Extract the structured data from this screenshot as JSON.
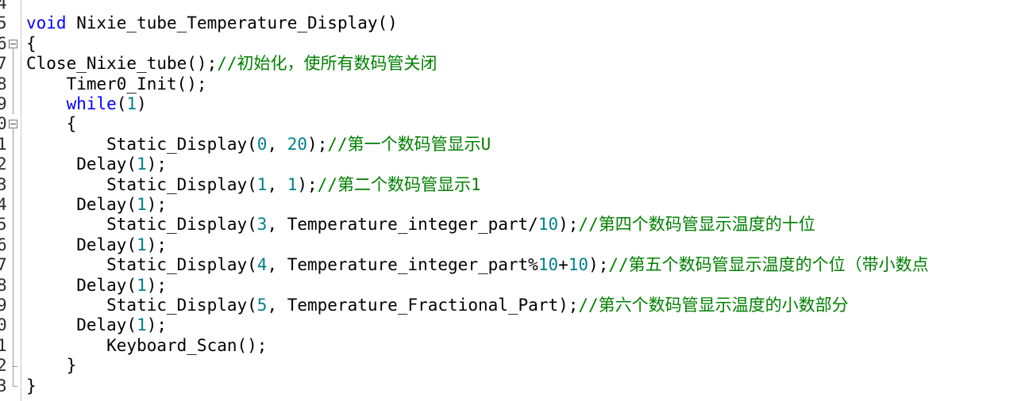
{
  "editor": {
    "colors": {
      "keyword": "#0000ff",
      "number": "#00808c",
      "comment": "#008000",
      "text": "#000000",
      "line_number": "#2b2b2b"
    },
    "lines": [
      {
        "number": "4",
        "fold": "none",
        "segments": []
      },
      {
        "number": "5",
        "fold": "none",
        "segments": [
          {
            "t": "kw",
            "v": "void"
          },
          {
            "t": "pl",
            "v": " Nixie_tube_Temperature_Display()"
          }
        ]
      },
      {
        "number": "6",
        "fold": "open",
        "segments": [
          {
            "t": "pl",
            "v": "{"
          }
        ]
      },
      {
        "number": "7",
        "fold": "line",
        "segments": [
          {
            "t": "pl",
            "v": "Close_Nixie_tube();"
          },
          {
            "t": "cmt",
            "v": "//初始化，使所有数码管关闭"
          }
        ]
      },
      {
        "number": "8",
        "fold": "line",
        "segments": [
          {
            "t": "pl",
            "v": "    Timer0_Init();"
          }
        ]
      },
      {
        "number": "9",
        "fold": "line",
        "segments": [
          {
            "t": "pl",
            "v": "    "
          },
          {
            "t": "kw",
            "v": "while"
          },
          {
            "t": "pl",
            "v": "("
          },
          {
            "t": "num",
            "v": "1"
          },
          {
            "t": "pl",
            "v": ")"
          }
        ]
      },
      {
        "number": "0",
        "fold": "open",
        "segments": [
          {
            "t": "pl",
            "v": "    {"
          }
        ]
      },
      {
        "number": "1",
        "fold": "line",
        "segments": [
          {
            "t": "pl",
            "v": "        Static_Display("
          },
          {
            "t": "num",
            "v": "0"
          },
          {
            "t": "pl",
            "v": ", "
          },
          {
            "t": "num",
            "v": "20"
          },
          {
            "t": "pl",
            "v": ");"
          },
          {
            "t": "cmt",
            "v": "//第一个数码管显示U"
          }
        ]
      },
      {
        "number": "2",
        "fold": "line",
        "segments": [
          {
            "t": "pl",
            "v": "     Delay("
          },
          {
            "t": "num",
            "v": "1"
          },
          {
            "t": "pl",
            "v": ");"
          }
        ]
      },
      {
        "number": "3",
        "fold": "line",
        "segments": [
          {
            "t": "pl",
            "v": "        Static_Display("
          },
          {
            "t": "num",
            "v": "1"
          },
          {
            "t": "pl",
            "v": ", "
          },
          {
            "t": "num",
            "v": "1"
          },
          {
            "t": "pl",
            "v": ");"
          },
          {
            "t": "cmt",
            "v": "//第二个数码管显示1"
          }
        ]
      },
      {
        "number": "4",
        "fold": "line",
        "segments": [
          {
            "t": "pl",
            "v": "     Delay("
          },
          {
            "t": "num",
            "v": "1"
          },
          {
            "t": "pl",
            "v": ");"
          }
        ]
      },
      {
        "number": "5",
        "fold": "line",
        "segments": [
          {
            "t": "pl",
            "v": "        Static_Display("
          },
          {
            "t": "num",
            "v": "3"
          },
          {
            "t": "pl",
            "v": ", Temperature_integer_part/"
          },
          {
            "t": "num",
            "v": "10"
          },
          {
            "t": "pl",
            "v": ");"
          },
          {
            "t": "cmt",
            "v": "//第四个数码管显示温度的十位"
          }
        ]
      },
      {
        "number": "6",
        "fold": "line",
        "segments": [
          {
            "t": "pl",
            "v": "     Delay("
          },
          {
            "t": "num",
            "v": "1"
          },
          {
            "t": "pl",
            "v": ");"
          }
        ]
      },
      {
        "number": "7",
        "fold": "line",
        "segments": [
          {
            "t": "pl",
            "v": "        Static_Display("
          },
          {
            "t": "num",
            "v": "4"
          },
          {
            "t": "pl",
            "v": ", Temperature_integer_part%"
          },
          {
            "t": "num",
            "v": "10"
          },
          {
            "t": "pl",
            "v": "+"
          },
          {
            "t": "num",
            "v": "10"
          },
          {
            "t": "pl",
            "v": ");"
          },
          {
            "t": "cmt",
            "v": "//第五个数码管显示温度的个位（带小数点"
          }
        ]
      },
      {
        "number": "8",
        "fold": "line",
        "segments": [
          {
            "t": "pl",
            "v": "     Delay("
          },
          {
            "t": "num",
            "v": "1"
          },
          {
            "t": "pl",
            "v": ");"
          }
        ]
      },
      {
        "number": "9",
        "fold": "line",
        "segments": [
          {
            "t": "pl",
            "v": "        Static_Display("
          },
          {
            "t": "num",
            "v": "5"
          },
          {
            "t": "pl",
            "v": ", Temperature_Fractional_Part);"
          },
          {
            "t": "cmt",
            "v": "//第六个数码管显示温度的小数部分"
          }
        ]
      },
      {
        "number": "0",
        "fold": "line",
        "segments": [
          {
            "t": "pl",
            "v": "     Delay("
          },
          {
            "t": "num",
            "v": "1"
          },
          {
            "t": "pl",
            "v": ");"
          }
        ]
      },
      {
        "number": "1",
        "fold": "line",
        "segments": [
          {
            "t": "pl",
            "v": "        Keyboard_Scan();"
          }
        ]
      },
      {
        "number": "2",
        "fold": "end",
        "segments": [
          {
            "t": "pl",
            "v": "    }"
          }
        ]
      },
      {
        "number": "3",
        "fold": "end",
        "segments": [
          {
            "t": "pl",
            "v": "}"
          }
        ]
      }
    ]
  }
}
